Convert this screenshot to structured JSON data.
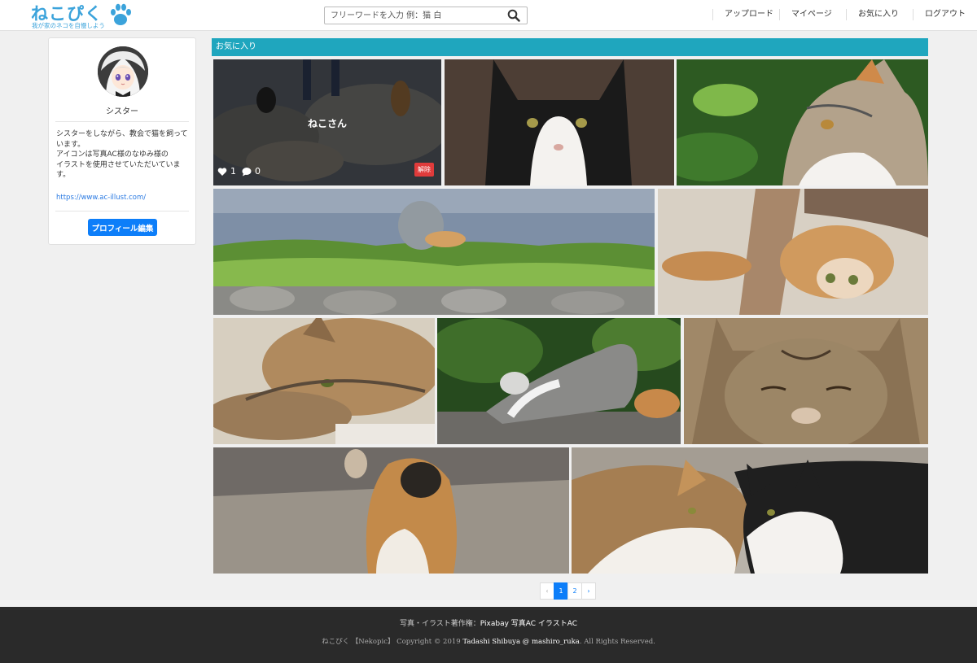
{
  "header": {
    "logo_title": "ねこぴく",
    "logo_subtitle": "我が家のネコを自慢しよう",
    "search_placeholder": "フリーワードを入力 例：猫 白",
    "nav": [
      "アップロード",
      "マイページ",
      "お気に入り",
      "ログアウト"
    ]
  },
  "profile": {
    "name": "シスター",
    "bio": "シスターをしながら、教会で猫を飼っています。\nアイコンは写真AC様のなゆみ様の\nイラストを使用させていただいています。",
    "link": "https://www.ac-illust.com/",
    "edit_button": "プロフィール編集"
  },
  "main": {
    "section_title": "お気に入り",
    "featured": {
      "title": "ねこさん",
      "likes": "1",
      "comments": "0",
      "remove_label": "解除"
    }
  },
  "pagination": {
    "prev": "‹",
    "pages": [
      "1",
      "2"
    ],
    "current": "1",
    "next": "›"
  },
  "footer": {
    "credits_label": "写真・イラスト著作権：",
    "credits_sources": "Pixabay 写真AC イラストAC",
    "copyright_prefix": "ねこぴく 【Nekopic】 Copyright © 2019 ",
    "copyright_author": "Tadashi Shibuya @ mashiro_ruka",
    "copyright_suffix": ". All Rights Reserved."
  },
  "colors": {
    "accent": "#1fa6be",
    "logo": "#3ba3db",
    "primary_button": "#0d7ef9",
    "remove_button": "#e03b3b",
    "footer_bg": "#2a2a2a"
  }
}
